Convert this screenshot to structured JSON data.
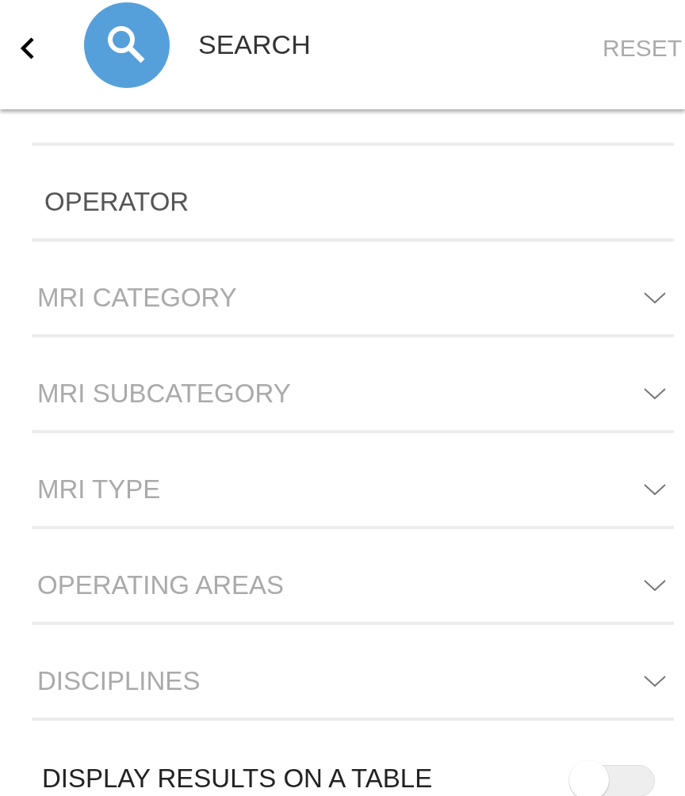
{
  "header": {
    "title": "SEARCH",
    "action": "RESET"
  },
  "fields": [
    {
      "kind": "input",
      "placeholder": "OPERATOR"
    },
    {
      "kind": "select",
      "label": "MRI CATEGORY"
    },
    {
      "kind": "select",
      "label": "MRI SUBCATEGORY"
    },
    {
      "kind": "select",
      "label": "MRI TYPE"
    },
    {
      "kind": "select",
      "label": "OPERATING AREAS"
    },
    {
      "kind": "select",
      "label": "DISCIPLINES"
    }
  ],
  "table_toggle": {
    "label": "DISPLAY RESULTS ON A TABLE",
    "on": false
  }
}
